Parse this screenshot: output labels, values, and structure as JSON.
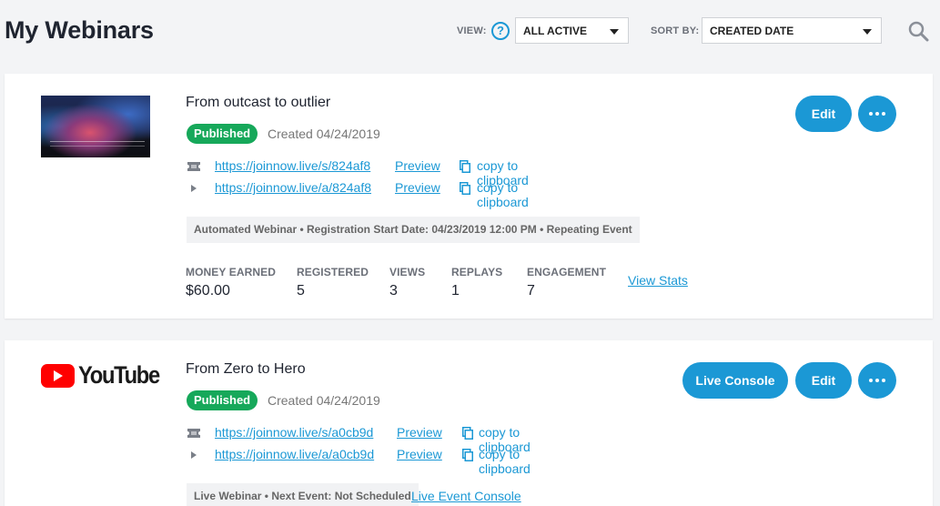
{
  "header": {
    "title": "My Webinars",
    "view_label": "VIEW:",
    "view_value": "ALL ACTIVE",
    "sort_label": "SORT BY:",
    "sort_value": "CREATED DATE",
    "help_glyph": "?"
  },
  "colors": {
    "accent": "#1b98d5",
    "published": "#16a85a",
    "youtube_red": "#ff0000"
  },
  "webinars": [
    {
      "title": "From outcast to outlier",
      "status": "Published",
      "created": "Created 04/24/2019",
      "registration_url": "https://joinnow.live/s/824af8",
      "attendee_url": "https://joinnow.live/a/824af8",
      "preview_label": "Preview",
      "copy_label": "copy to clipboard",
      "info": "Automated Webinar • Registration Start Date: 04/23/2019 12:00 PM • Repeating Event",
      "stats": [
        {
          "label": "MONEY EARNED",
          "value": "$60.00"
        },
        {
          "label": "REGISTERED",
          "value": "5"
        },
        {
          "label": "VIEWS",
          "value": "3"
        },
        {
          "label": "REPLAYS",
          "value": "1"
        },
        {
          "label": "ENGAGEMENT",
          "value": "7"
        }
      ],
      "view_stats_label": "View Stats",
      "edit_label": "Edit"
    },
    {
      "title": "From Zero to Hero",
      "logo_text": "YouTube",
      "status": "Published",
      "created": "Created 04/24/2019",
      "registration_url": "https://joinnow.live/s/a0cb9d",
      "attendee_url": "https://joinnow.live/a/a0cb9d",
      "preview_label": "Preview",
      "copy_label": "copy to clipboard",
      "info": "Live Webinar • Next Event: Not Scheduled",
      "console_link_label": "Live Event Console",
      "live_console_label": "Live Console",
      "edit_label": "Edit"
    }
  ]
}
